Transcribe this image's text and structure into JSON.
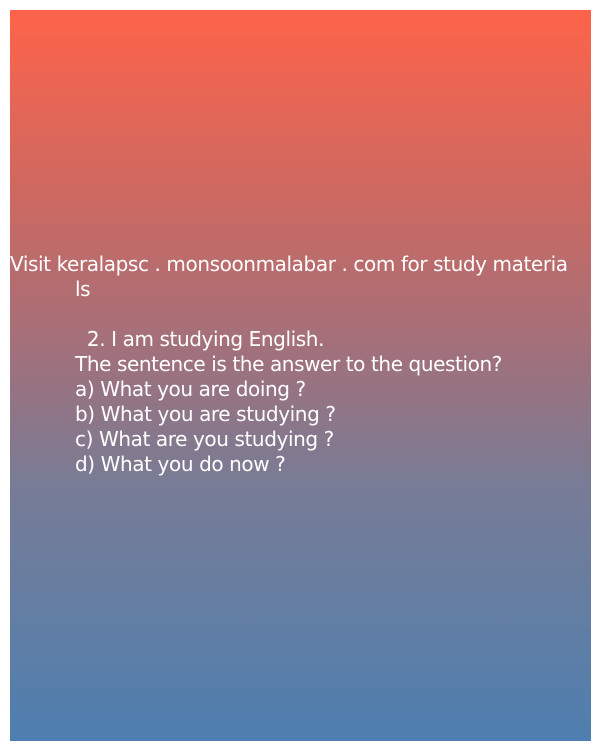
{
  "card": {
    "header_line1": "Visit keralapsc . monsoonmalabar . com for study materia",
    "header_line2": "ls",
    "question": "  2. I am studying English.",
    "prompt": "The sentence is the answer to the question?",
    "options": [
      "a) What you are doing ?",
      "b) What you are studying ?",
      "c) What are you studying ?",
      "d) What you do now ?"
    ]
  },
  "colors": {
    "gradient_top": "#fe6349",
    "gradient_bottom": "#4e7fb0",
    "text": "#ffffff"
  }
}
